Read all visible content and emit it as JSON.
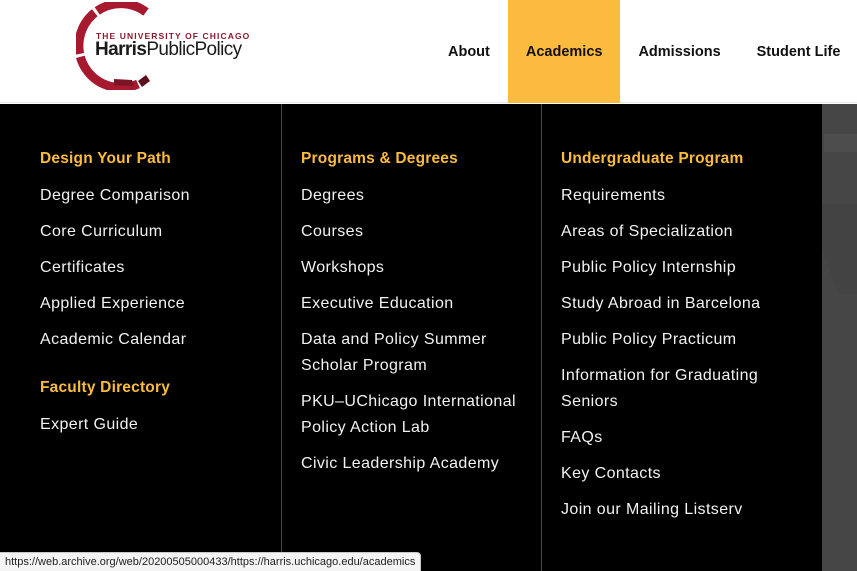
{
  "logo": {
    "university": "THE UNIVERSITY OF CHICAGO",
    "name_bold": "Harris",
    "name_regular": "PublicPolicy",
    "colors": {
      "red": "#a6192e",
      "dark_red": "#6a1020"
    }
  },
  "nav": {
    "items": [
      {
        "label": "About",
        "active": false
      },
      {
        "label": "Academics",
        "active": true
      },
      {
        "label": "Admissions",
        "active": false
      },
      {
        "label": "Student Life",
        "active": false
      }
    ],
    "active_color": "#fbbb3f"
  },
  "menu": {
    "columns": [
      {
        "groups": [
          {
            "heading": "Design Your Path",
            "links": [
              "Degree Comparison",
              "Core Curriculum",
              "Certificates",
              "Applied Experience",
              "Academic Calendar"
            ]
          },
          {
            "heading": "Faculty Directory",
            "links": [
              "Expert Guide"
            ]
          }
        ]
      },
      {
        "groups": [
          {
            "heading": "Programs & Degrees",
            "links": [
              "Degrees",
              "Courses",
              "Workshops",
              "Executive Education",
              "Data and Policy Summer Scholar Program",
              "PKU–UChicago International Policy Action Lab",
              "Civic Leadership Academy"
            ]
          }
        ]
      },
      {
        "groups": [
          {
            "heading": "Undergraduate Program",
            "links": [
              "Requirements",
              "Areas of Specialization",
              "Public Policy Internship",
              "Study Abroad in Barcelona",
              "Public Policy Practicum",
              "Information for Graduating Seniors",
              "FAQs",
              "Key Contacts",
              "Join our Mailing Listserv"
            ]
          }
        ]
      }
    ],
    "heading_color": "#fbbb3f"
  },
  "status_bar": {
    "url": "https://web.archive.org/web/20200505000433/https://harris.uchicago.edu/academics"
  }
}
